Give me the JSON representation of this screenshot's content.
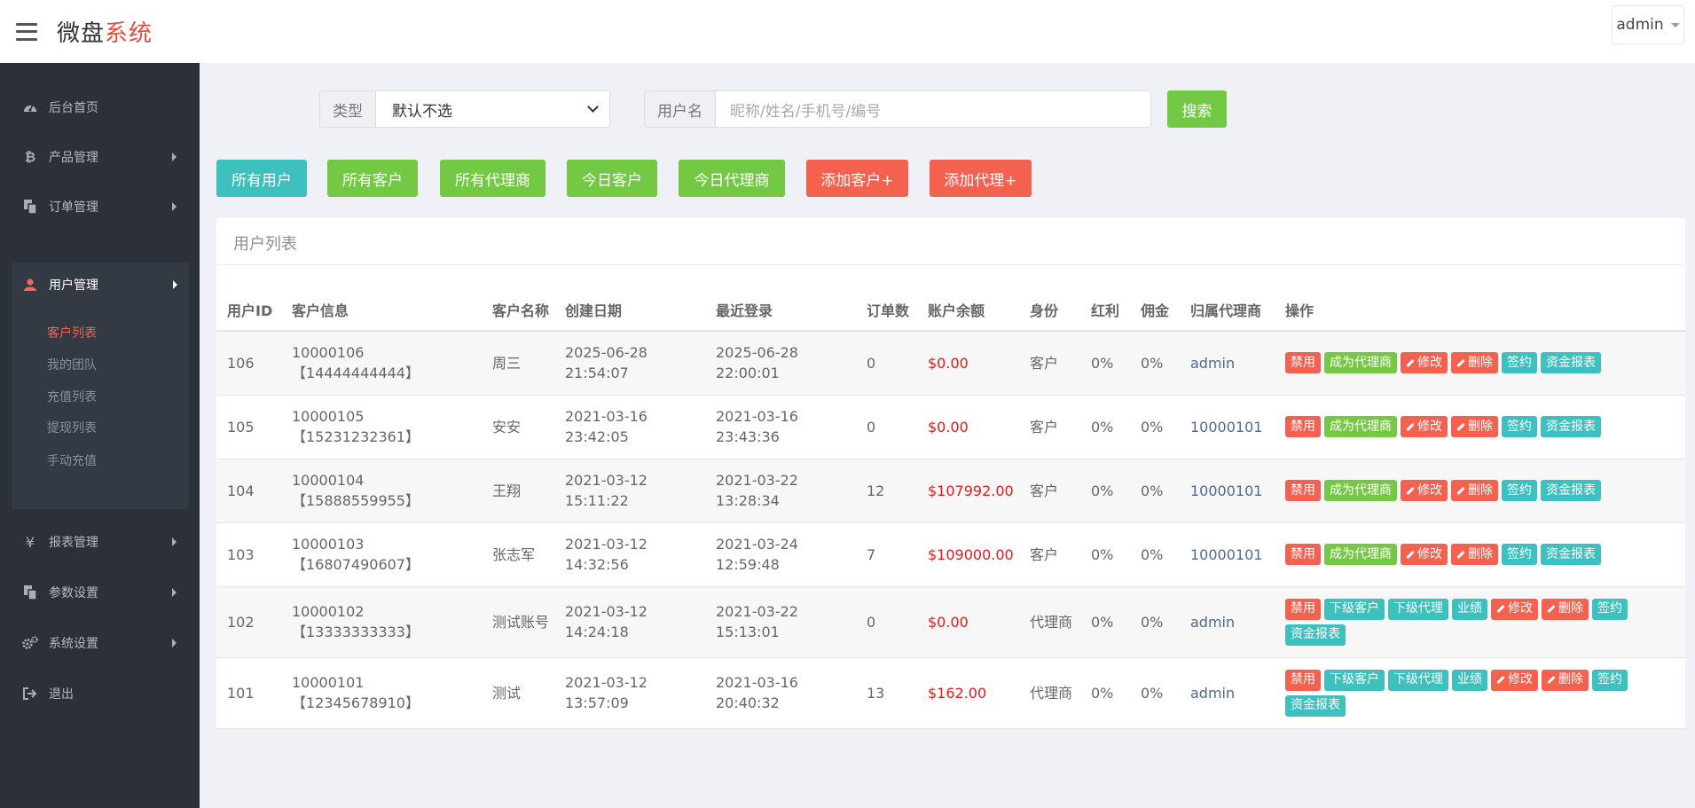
{
  "header": {
    "logo_main": "微盘",
    "logo_accent": "系统",
    "user": "admin"
  },
  "sidebar": {
    "items": [
      {
        "key": "home",
        "label": "后台首页",
        "icon": "dashboard-icon"
      },
      {
        "key": "products",
        "label": "产品管理",
        "icon": "bitcoin-icon"
      },
      {
        "key": "orders",
        "label": "订单管理",
        "icon": "copy-icon"
      },
      {
        "key": "users",
        "label": "用户管理",
        "icon": "user-icon"
      },
      {
        "key": "reports",
        "label": "报表管理",
        "icon": "yen-icon"
      },
      {
        "key": "params",
        "label": "参数设置",
        "icon": "copy-icon"
      },
      {
        "key": "system",
        "label": "系统设置",
        "icon": "gears-icon"
      },
      {
        "key": "logout",
        "label": "退出",
        "icon": "sign-out-icon"
      }
    ],
    "user_submenu": [
      "客户列表",
      "我的团队",
      "充值列表",
      "提现列表",
      "手动充值"
    ],
    "active_submenu": "客户列表"
  },
  "filters": {
    "type_label": "类型",
    "type_value": "默认不选",
    "username_label": "用户名",
    "username_placeholder": "昵称/姓名/手机号/编号",
    "search_button": "搜索"
  },
  "tabs": [
    "所有用户",
    "所有客户",
    "所有代理商",
    "今日客户",
    "今日代理商",
    "添加客户+",
    "添加代理+"
  ],
  "panel": {
    "title": "用户列表",
    "columns": [
      "用户ID",
      "客户信息",
      "客户名称",
      "创建日期",
      "最近登录",
      "订单数",
      "账户余额",
      "身份",
      "红利",
      "佣金",
      "归属代理商",
      "操作"
    ],
    "rows": [
      {
        "id": "106",
        "info1": "10000106",
        "info2": "【14444444444】",
        "name": "周三",
        "created1": "2025-06-28",
        "created2": "21:54:07",
        "login1": "2025-06-28",
        "login2": "22:00:01",
        "orders": "0",
        "balance": "$0.00",
        "role": "客户",
        "bonus": "0%",
        "commission": "0%",
        "agent": "admin"
      },
      {
        "id": "105",
        "info1": "10000105",
        "info2": "【15231232361】",
        "name": "安安",
        "created1": "2021-03-16",
        "created2": "23:42:05",
        "login1": "2021-03-16",
        "login2": "23:43:36",
        "orders": "0",
        "balance": "$0.00",
        "role": "客户",
        "bonus": "0%",
        "commission": "0%",
        "agent": "10000101"
      },
      {
        "id": "104",
        "info1": "10000104",
        "info2": "【15888559955】",
        "name": "王翔",
        "created1": "2021-03-12",
        "created2": "15:11:22",
        "login1": "2021-03-22",
        "login2": "13:28:34",
        "orders": "12",
        "balance": "$107992.00",
        "role": "客户",
        "bonus": "0%",
        "commission": "0%",
        "agent": "10000101"
      },
      {
        "id": "103",
        "info1": "10000103",
        "info2": "【16807490607】",
        "name": "张志军",
        "created1": "2021-03-12",
        "created2": "14:32:56",
        "login1": "2021-03-24",
        "login2": "12:59:48",
        "orders": "7",
        "balance": "$109000.00",
        "role": "客户",
        "bonus": "0%",
        "commission": "0%",
        "agent": "10000101"
      },
      {
        "id": "102",
        "info1": "10000102",
        "info2": "【13333333333】",
        "name": "测试账号",
        "created1": "2021-03-12",
        "created2": "14:24:18",
        "login1": "2021-03-22",
        "login2": "15:13:01",
        "orders": "0",
        "balance": "$0.00",
        "role": "代理商",
        "bonus": "0%",
        "commission": "0%",
        "agent": "admin"
      },
      {
        "id": "101",
        "info1": "10000101",
        "info2": "【12345678910】",
        "name": "测试",
        "created1": "2021-03-12",
        "created2": "13:57:09",
        "login1": "2021-03-16",
        "login2": "20:40:32",
        "orders": "13",
        "balance": "$162.00",
        "role": "代理商",
        "bonus": "0%",
        "commission": "0%",
        "agent": "admin"
      }
    ],
    "customer_ops": [
      "禁用",
      "成为代理商",
      "修改",
      "删除",
      "签约",
      "资金报表"
    ],
    "agent_ops": [
      "禁用",
      "下级客户",
      "下级代理",
      "业绩",
      "修改",
      "删除",
      "签约",
      "资金报表"
    ]
  },
  "colors": {
    "sidebar": "#2b3039",
    "green": "#74c944",
    "teal": "#3dc0be",
    "red": "#f4614f",
    "money": "#e41b1b"
  }
}
